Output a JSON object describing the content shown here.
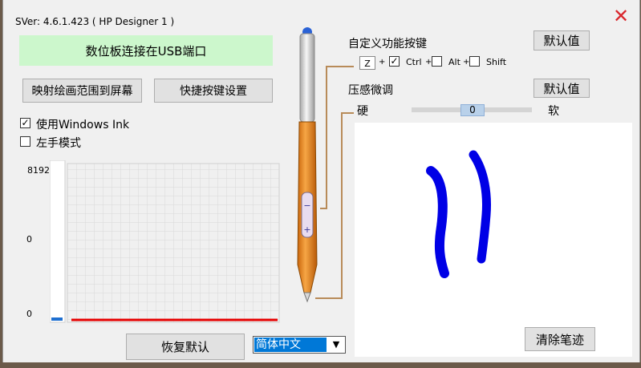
{
  "version_text": "SVer: 4.6.1.423  ( HP Designer 1 )",
  "close_glyph": "✕",
  "status_banner": "数位板连接在USB端口",
  "buttons": {
    "map_area": "映射绘画范围到屏幕",
    "shortcut_settings": "快捷按键设置",
    "restore_defaults": "恢复默认",
    "clear_strokes": "清除笔迹",
    "default1": "默认值",
    "default2": "默认值"
  },
  "options": {
    "windows_ink": {
      "label": "使用Windows Ink",
      "checked": true
    },
    "left_hand": {
      "label": "左手模式",
      "checked": false
    }
  },
  "pressure_chart": {
    "y_labels": [
      "8192",
      "0",
      "0"
    ]
  },
  "custom_keys": {
    "title": "自定义功能按键",
    "key_value": "Z",
    "plus": "+",
    "ctrl": {
      "label": "Ctrl",
      "checked": true
    },
    "alt": {
      "label": "Alt",
      "checked": false
    },
    "shift": {
      "label": "Shift",
      "checked": false
    }
  },
  "pressure_tune": {
    "title": "压感微调",
    "left_label": "硬",
    "right_label": "软",
    "value": "0"
  },
  "language": {
    "selected": "简体中文",
    "arrow": "▼"
  },
  "colors": {
    "banner_bg": "#ccf7cc",
    "ink": "#0000e6",
    "pressure_line": "#e60000",
    "pen_body": "#e88a22",
    "close": "#d9262c"
  }
}
